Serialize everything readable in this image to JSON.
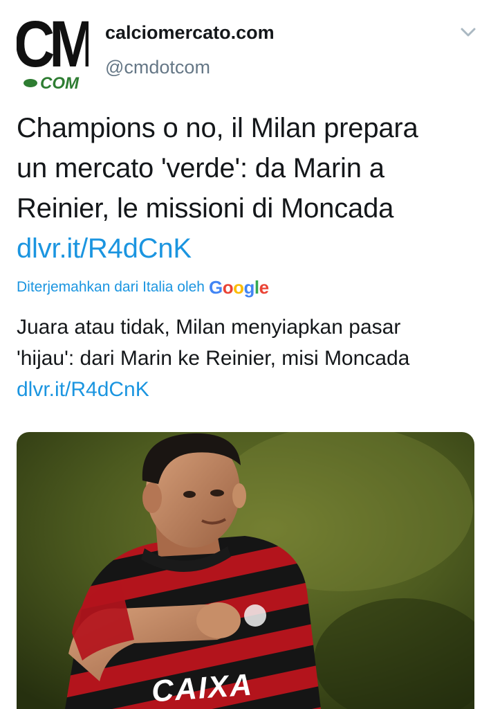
{
  "tweet": {
    "account": {
      "display_name": "calciomercato.com",
      "handle": "@cmdotcom",
      "avatar_text_top": "CM",
      "avatar_text_bottom": "COM",
      "avatar_colors": {
        "ink": "#111111",
        "accent": "#2e7d32"
      }
    },
    "menu_icon": "chevron-down-icon",
    "text_lines": [
      "Champions o no, il Milan prepara",
      "un mercato 'verde': da Marin a",
      "Reinier, le missioni di Moncada"
    ],
    "link": "dlvr.it/R4dCnK",
    "translation": {
      "label": "Diterjemahkan dari Italia oleh",
      "provider": "Google",
      "lines": [
        "Juara atau tidak, Milan menyiapkan pasar",
        "'hijau': dari Marin ke Reinier, misi Moncada"
      ],
      "link": "dlvr.it/R4dCnK"
    },
    "media": {
      "description": "photo",
      "jersey_text": "CAIXA"
    }
  },
  "colors": {
    "link": "#1b95e0",
    "text": "#14171a",
    "secondary": "#657786"
  }
}
